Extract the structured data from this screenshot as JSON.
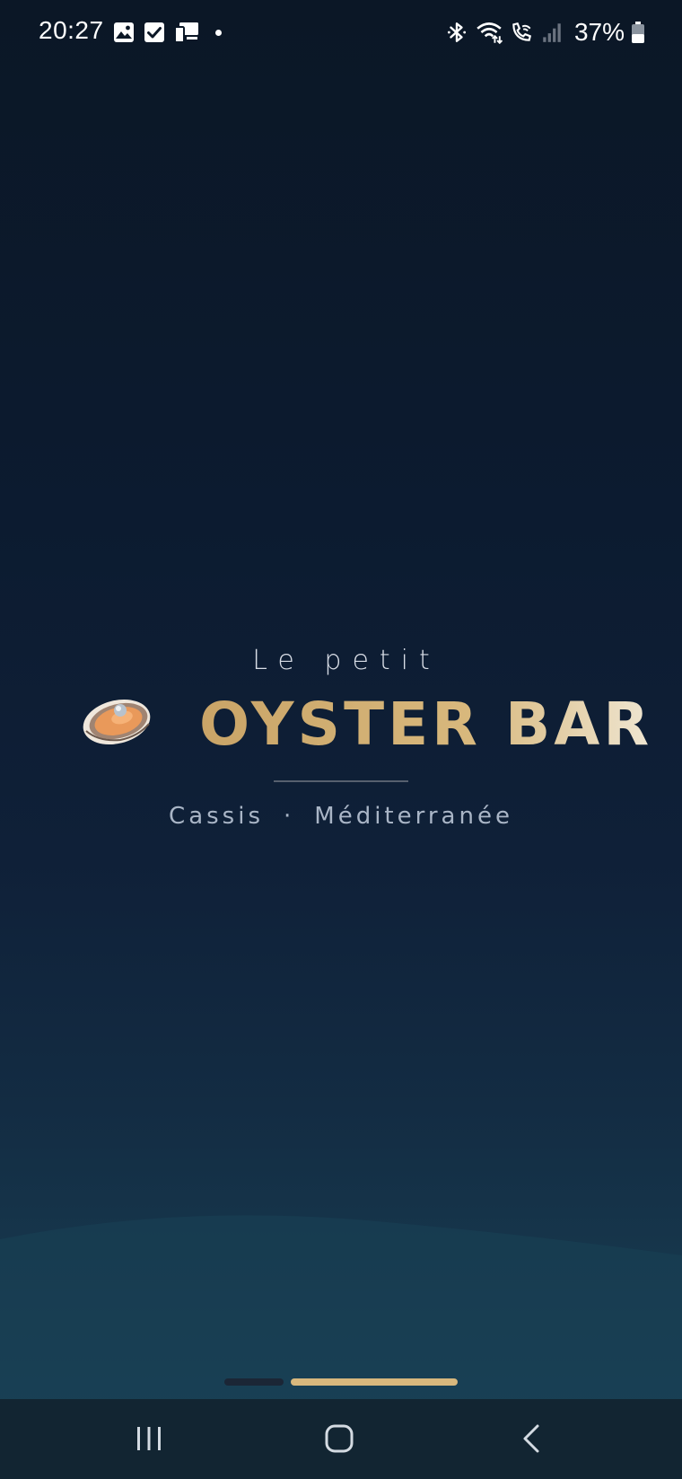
{
  "status_bar": {
    "time": "20:27",
    "left_icons": [
      "gallery-icon",
      "checkbox-icon",
      "cast-icon",
      "dot-icon"
    ],
    "right_icons": [
      "bluetooth-icon",
      "wifi-icon",
      "wifi-calling-icon",
      "signal-icon"
    ],
    "battery_percent": "37%"
  },
  "splash": {
    "subtitle": "Le petit",
    "title": "OYSTER BAR",
    "tagline_left": "Cassis",
    "tagline_sep": "·",
    "tagline_right": "Méditerranée",
    "logo_icon": "oyster-icon"
  },
  "colors": {
    "background_top": "#0b1726",
    "background_bottom": "#1a4156",
    "gold": "#d8b87d",
    "text_light": "#d8dde6",
    "tagline": "#a9b5c6"
  },
  "pager": {
    "pages": 2,
    "active_index": 1
  },
  "nav_bar": {
    "buttons": [
      "recents-icon",
      "home-icon",
      "back-icon"
    ]
  }
}
